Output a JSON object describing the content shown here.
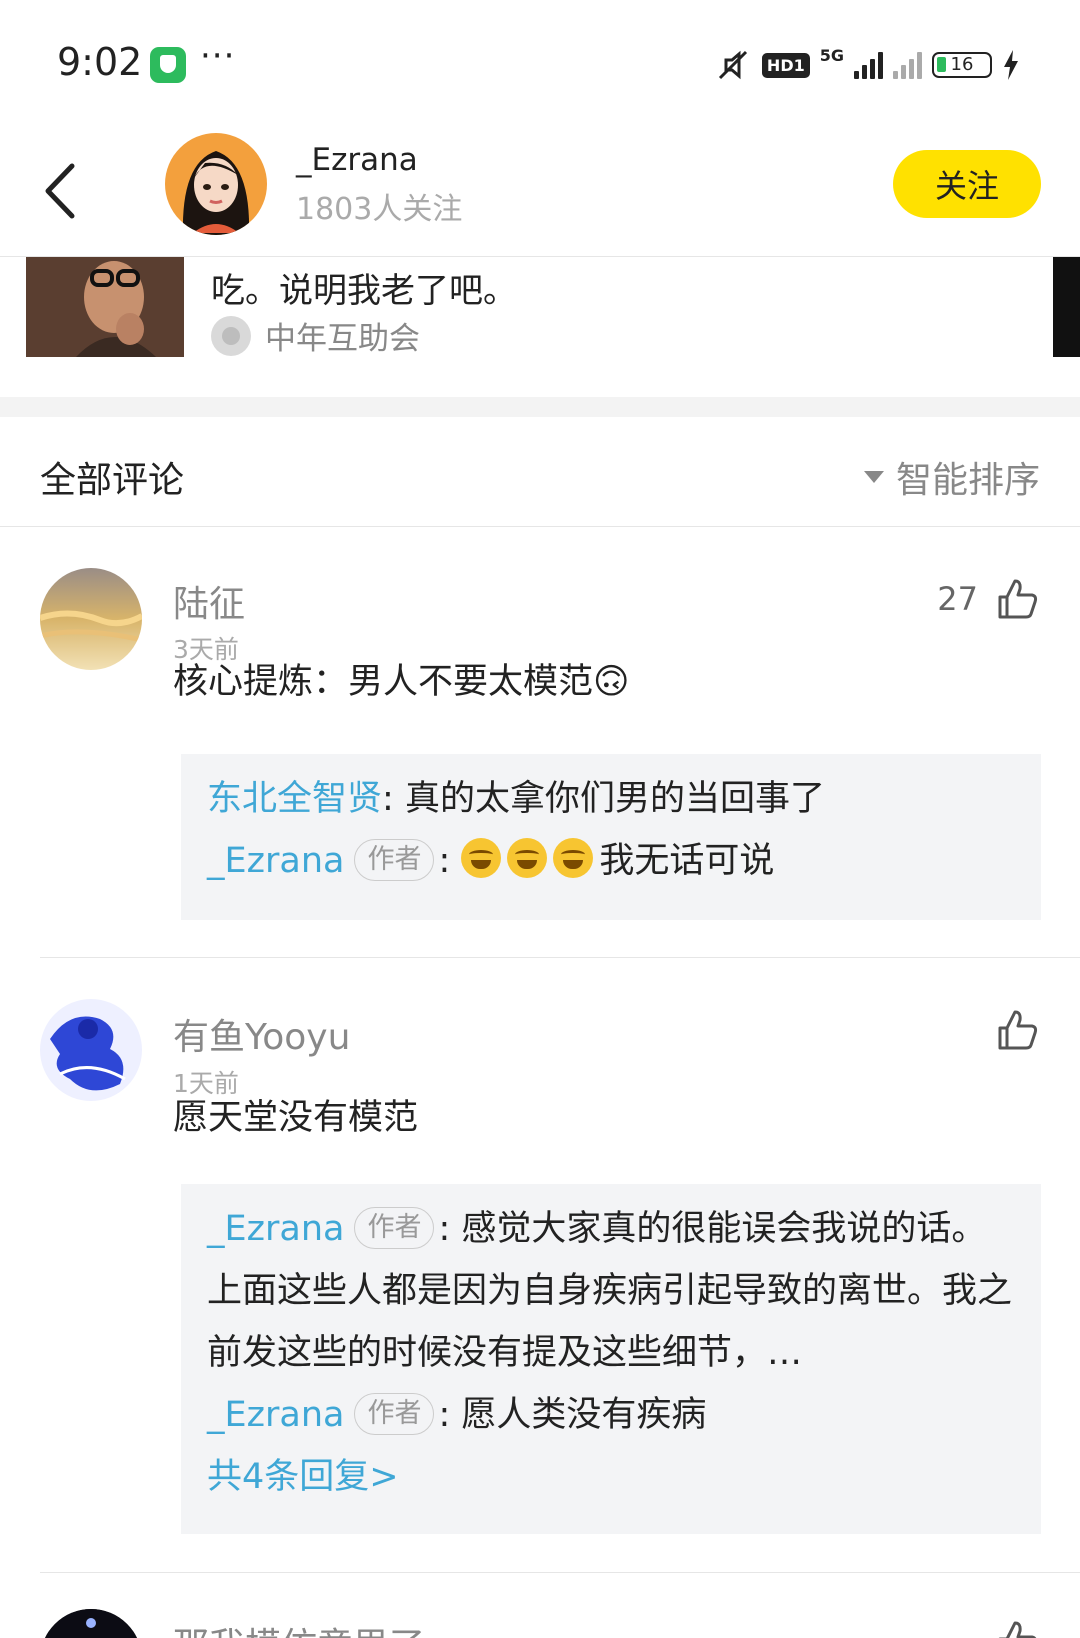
{
  "status_bar": {
    "time": "9:02",
    "dots": "···",
    "network": "5G",
    "hd": "HD1",
    "battery": "16"
  },
  "header": {
    "name": "_Ezrana",
    "followers": "1803人关注",
    "follow_label": "关注"
  },
  "ref_post": {
    "text": "吃。说明我老了吧。",
    "topic": "中年互助会"
  },
  "comments_header": {
    "title": "全部评论",
    "sort_label": "智能排序"
  },
  "comments": [
    {
      "user": "陆征",
      "time": "3天前",
      "likes": "27",
      "text": "核心提炼：男人不要太模范🙃",
      "replies": [
        {
          "user": "东北全智贤",
          "sep": ": ",
          "text": "真的太拿你们男的当回事了"
        },
        {
          "user": "_Ezrana",
          "tag": "作者",
          "sep": ": ",
          "text": "我无话可说",
          "emoji_count": 3
        }
      ]
    },
    {
      "user": "有鱼Yooyu",
      "time": "1天前",
      "likes": "",
      "text": "愿天堂没有模范",
      "replies": [
        {
          "user": "_Ezrana",
          "tag": "作者",
          "sep": ": ",
          "text": "感觉大家真的很能误会我说的话。上面这些人都是因为自身疾病引起导致的离世。我之前发这些的时候没有提及这些细节，…"
        },
        {
          "user": "_Ezrana",
          "tag": "作者",
          "sep": ": ",
          "text": "愿人类没有疾病"
        }
      ],
      "more": "共4条回复>"
    },
    {
      "user": "那我模仿意思了"
    }
  ],
  "colors": {
    "accent_yellow": "#ffe100",
    "link_blue": "#3fa7d6"
  }
}
